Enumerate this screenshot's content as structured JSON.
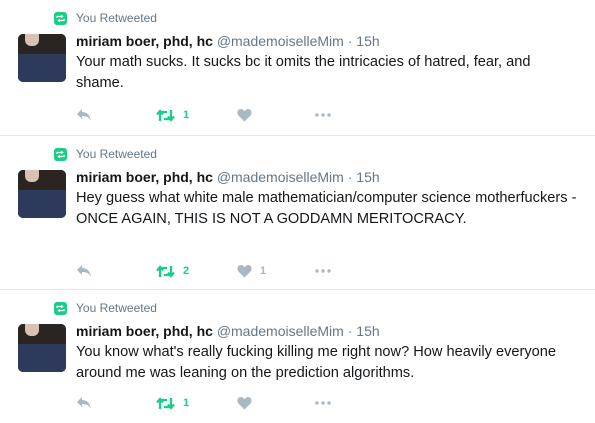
{
  "colors": {
    "retweet_green": "#19cf86",
    "muted_gray": "#657786",
    "icon_gray": "#aab8c2",
    "divider": "#e1e8ed"
  },
  "tweets": [
    {
      "context_label": "You Retweeted",
      "author_name": "miriam boer, phd, hc",
      "handle": "@mademoiselleMim",
      "separator": "·",
      "time": "15h",
      "text": "Your math sucks. It sucks bc it omits the intricacies of hatred, fear, and shame.",
      "retweet_count": "1",
      "like_count": "",
      "retweeted": true,
      "icons": [
        "retweet-icon",
        "reply-icon",
        "retweet-icon",
        "like-icon",
        "more-icon"
      ]
    },
    {
      "context_label": "You Retweeted",
      "author_name": "miriam boer, phd, hc",
      "handle": "@mademoiselleMim",
      "separator": "·",
      "time": "15h",
      "text": "Hey guess what white male mathematician/computer science motherfuckers - ONCE AGAIN, THIS IS NOT A GODDAMN MERITOCRACY.",
      "retweet_count": "2",
      "like_count": "1",
      "retweeted": true,
      "icons": [
        "retweet-icon",
        "reply-icon",
        "retweet-icon",
        "like-icon",
        "more-icon"
      ]
    },
    {
      "context_label": "You Retweeted",
      "author_name": "miriam boer, phd, hc",
      "handle": "@mademoiselleMim",
      "separator": "·",
      "time": "15h",
      "text": "You know what's really fucking killing me right now? How heavily everyone around me was leaning on the prediction algorithms.",
      "retweet_count": "1",
      "like_count": "",
      "retweeted": true,
      "icons": [
        "retweet-icon",
        "reply-icon",
        "retweet-icon",
        "like-icon",
        "more-icon"
      ]
    }
  ]
}
